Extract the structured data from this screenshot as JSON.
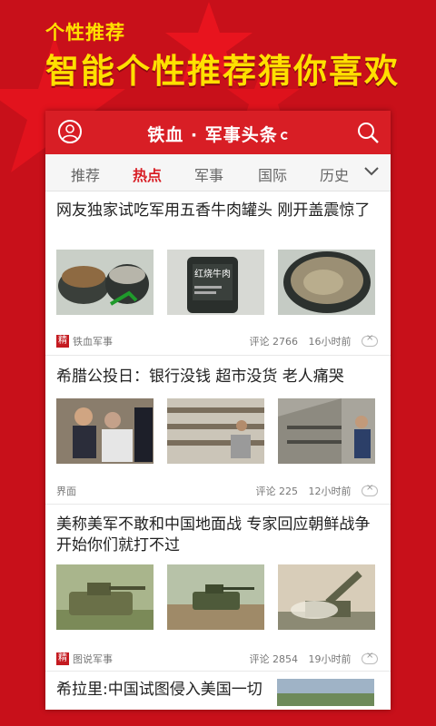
{
  "promo": {
    "tagline_small": "个性推荐",
    "tagline_big": "智能个性推荐猜你喜欢"
  },
  "app": {
    "title": "铁血 · 军事头条",
    "avatar_icon": "user-icon",
    "search_icon": "search-icon",
    "accent_color": "#d81e25"
  },
  "tabs": [
    {
      "label": "推荐",
      "active": false
    },
    {
      "label": "热点",
      "active": true
    },
    {
      "label": "军事",
      "active": false
    },
    {
      "label": "国际",
      "active": false
    },
    {
      "label": "历史",
      "active": false
    }
  ],
  "articles": [
    {
      "title": "网友独家试吃军用五香牛肉罐头 刚开盖震惊了",
      "source": "铁血军事",
      "badge": "精",
      "comments": "评论 2766",
      "time": "16小时前",
      "thumbs": [
        "tin-can-opened",
        "beef-can-label",
        "can-contents"
      ],
      "can_label": "红烧牛肉"
    },
    {
      "title": "希腊公投日：银行没钱 超市没货 老人痛哭",
      "source": "界面",
      "badge": "",
      "comments": "评论 225",
      "time": "12小时前",
      "thumbs": [
        "elderly-man-crying",
        "empty-shelves",
        "empty-store"
      ]
    },
    {
      "title": "美称美军不敢和中国地面战 专家回应朝鲜战争开始你们就打不过",
      "source": "图说军事",
      "badge": "精",
      "comments": "评论 2854",
      "time": "19小时前",
      "thumbs": [
        "armored-vehicle",
        "tank-field",
        "rocket-launcher"
      ]
    },
    {
      "title": "希拉里:中国试图侵入美国一切",
      "thumbs": [
        "landscape"
      ]
    }
  ]
}
